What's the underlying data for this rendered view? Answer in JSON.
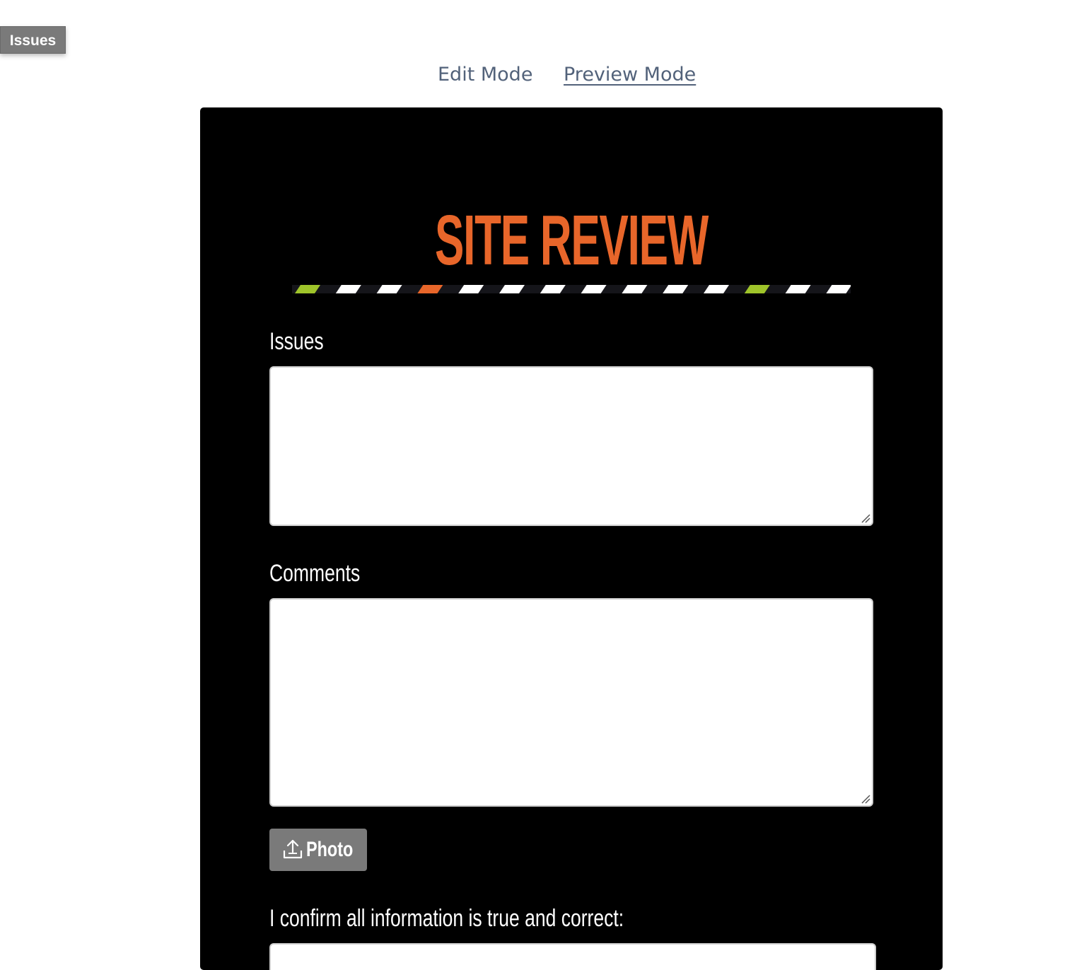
{
  "floating_tag": {
    "label": "Issues"
  },
  "mode_nav": {
    "edit_label": "Edit Mode",
    "preview_label": "Preview Mode",
    "active": "Preview Mode"
  },
  "form": {
    "logo_text": "SITE REVIEW",
    "fields": {
      "issues_label": "Issues",
      "issues_value": "",
      "comments_label": "Comments",
      "comments_value": "",
      "photo_button_label": "Photo",
      "confirm_label": "I confirm all information is true and correct:"
    }
  },
  "colors": {
    "card_background": "#000000",
    "logo_orange": "#e8662a",
    "stripe_green": "#9fc42a",
    "button_gray": "#7a7a7a",
    "nav_link": "#52627a"
  },
  "icons": {
    "photo_button_icon": "upload-icon",
    "textarea_grip": "resize-grip-icon"
  }
}
